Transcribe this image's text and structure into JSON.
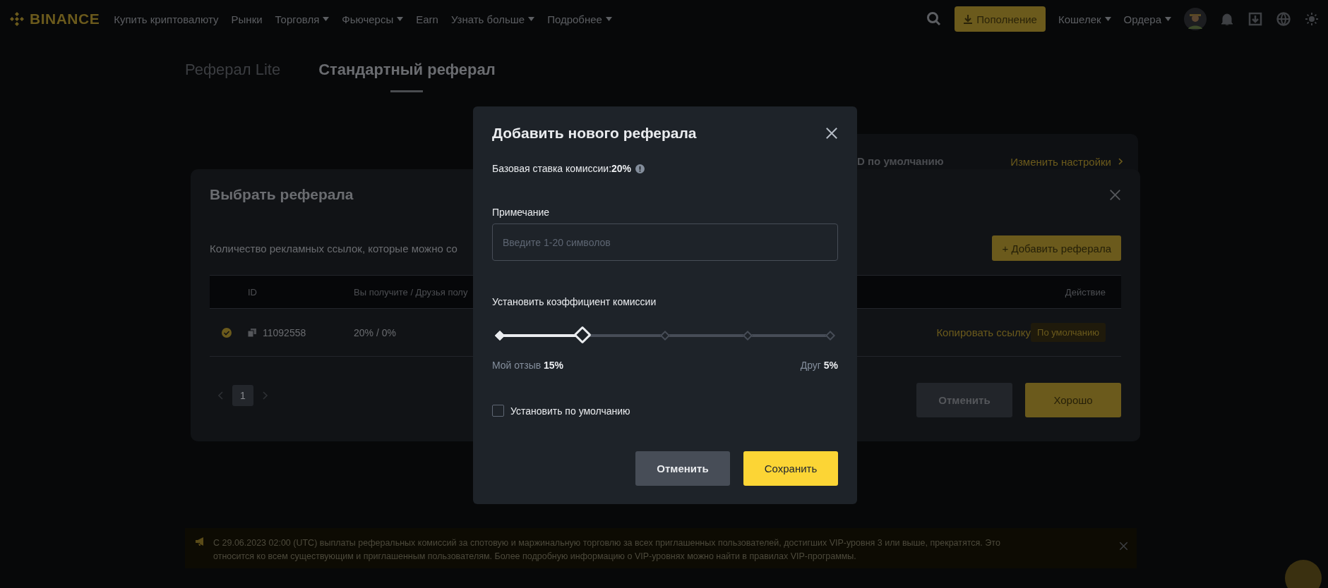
{
  "nav": {
    "logo": "BINANCE",
    "items": [
      {
        "label": "Купить криптовалюту",
        "dropdown": false
      },
      {
        "label": "Рынки",
        "dropdown": false
      },
      {
        "label": "Торговля",
        "dropdown": true
      },
      {
        "label": "Фьючерсы",
        "dropdown": true
      },
      {
        "label": "Earn",
        "dropdown": false
      },
      {
        "label": "Узнать больше",
        "dropdown": true
      },
      {
        "label": "Подробнее",
        "dropdown": true
      }
    ],
    "deposit": "Пополнение",
    "right_items": [
      {
        "label": "Кошелек",
        "dropdown": true
      },
      {
        "label": "Ордера",
        "dropdown": true
      }
    ]
  },
  "tabs": [
    {
      "label": "Реферал Lite",
      "selected": false
    },
    {
      "label": "Стандартный реферал",
      "selected": true
    }
  ],
  "background_card": {
    "label": "D по умолчанию",
    "link": "Изменить настройки"
  },
  "select_dialog": {
    "title": "Выбрать реферала",
    "description": "Количество рекламных ссылок, которые можно со",
    "add_button": "+ Добавить реферала",
    "columns": [
      "ID",
      "Вы получите / Друзья полу",
      "Действие"
    ],
    "rows": [
      {
        "selected": true,
        "id": "11092558",
        "share": "20% / 0%",
        "action": "Копировать ссылку",
        "badge": "По умолчанию"
      }
    ],
    "pages": [
      {
        "label": "1",
        "selected": true
      }
    ],
    "buttons": [
      {
        "label": "Отменить",
        "kind": "secondary"
      },
      {
        "label": "Хорошо",
        "kind": "primary"
      }
    ]
  },
  "add_dialog": {
    "title": "Добавить нового реферала",
    "base_rate": "Базовая ставка комиссии:**20%**",
    "note_label": "Примечание",
    "note_placeholder": "Введите 1-20 символов",
    "rate_label": "Установить коэффициент комиссии",
    "rate": {
      "level": 0.25
    },
    "mine": "Мой отзыв **15%**",
    "friend": "Друг **5%**",
    "default_checkbox": {
      "label": "Установить по умолчанию",
      "checked": false
    },
    "buttons": [
      {
        "label": "Отменить",
        "kind": "secondary"
      },
      {
        "label": "Сохранить",
        "kind": "primary"
      }
    ]
  },
  "banner": {
    "text": "С 29.06.2023 02:00 (UTC) выплаты реферальных комиссий за спотовую и маржинальную торговлю за всех приглашенных пользователей, достигших VIP-уровня 3 или выше, прекратятся. Это относится ко всем существующим и приглашенным пользователям. Более подробную информацию о VIP-уровнях можно найти в правилах VIP-программы."
  }
}
